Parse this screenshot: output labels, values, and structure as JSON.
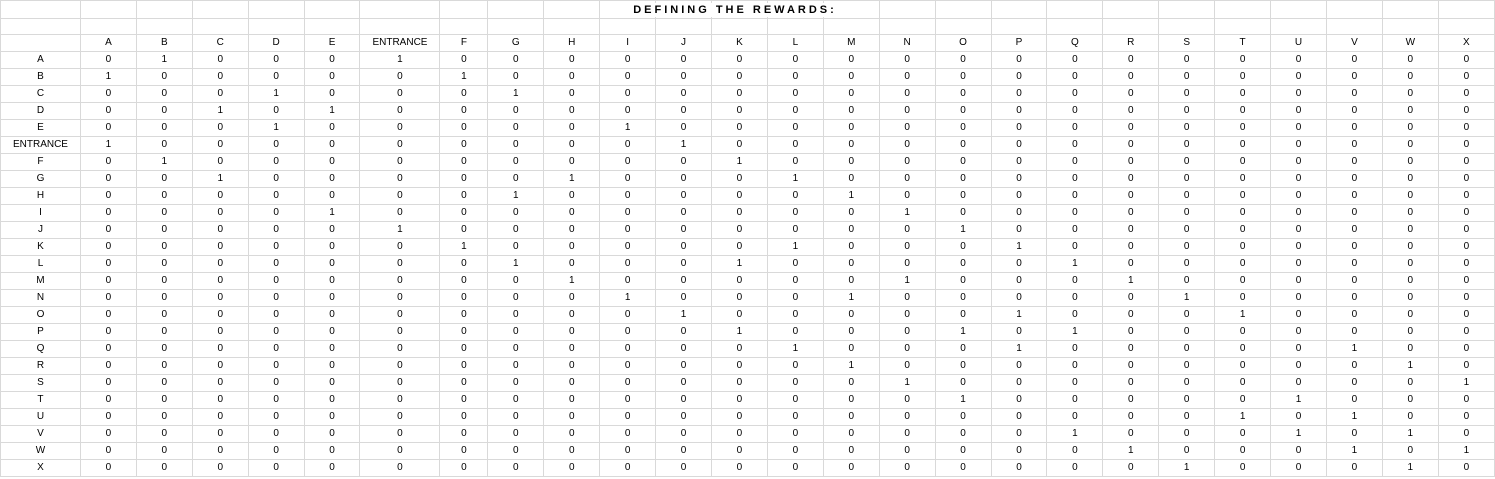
{
  "title": "DEFINING THE REWARDS:",
  "columns": [
    "A",
    "B",
    "C",
    "D",
    "E",
    "ENTRANCE",
    "F",
    "G",
    "H",
    "I",
    "J",
    "K",
    "L",
    "M",
    "N",
    "O",
    "P",
    "Q",
    "R",
    "S",
    "T",
    "U",
    "V",
    "W",
    "X"
  ],
  "rows": [
    {
      "label": "A",
      "values": [
        0,
        1,
        0,
        0,
        0,
        1,
        0,
        0,
        0,
        0,
        0,
        0,
        0,
        0,
        0,
        0,
        0,
        0,
        0,
        0,
        0,
        0,
        0,
        0,
        0
      ]
    },
    {
      "label": "B",
      "values": [
        1,
        0,
        0,
        0,
        0,
        0,
        1,
        0,
        0,
        0,
        0,
        0,
        0,
        0,
        0,
        0,
        0,
        0,
        0,
        0,
        0,
        0,
        0,
        0,
        0
      ]
    },
    {
      "label": "C",
      "values": [
        0,
        0,
        0,
        1,
        0,
        0,
        0,
        1,
        0,
        0,
        0,
        0,
        0,
        0,
        0,
        0,
        0,
        0,
        0,
        0,
        0,
        0,
        0,
        0,
        0
      ]
    },
    {
      "label": "D",
      "values": [
        0,
        0,
        1,
        0,
        1,
        0,
        0,
        0,
        0,
        0,
        0,
        0,
        0,
        0,
        0,
        0,
        0,
        0,
        0,
        0,
        0,
        0,
        0,
        0,
        0
      ]
    },
    {
      "label": "E",
      "values": [
        0,
        0,
        0,
        1,
        0,
        0,
        0,
        0,
        0,
        1,
        0,
        0,
        0,
        0,
        0,
        0,
        0,
        0,
        0,
        0,
        0,
        0,
        0,
        0,
        0
      ]
    },
    {
      "label": "ENTRANCE",
      "values": [
        1,
        0,
        0,
        0,
        0,
        0,
        0,
        0,
        0,
        0,
        1,
        0,
        0,
        0,
        0,
        0,
        0,
        0,
        0,
        0,
        0,
        0,
        0,
        0,
        0
      ]
    },
    {
      "label": "F",
      "values": [
        0,
        1,
        0,
        0,
        0,
        0,
        0,
        0,
        0,
        0,
        0,
        1,
        0,
        0,
        0,
        0,
        0,
        0,
        0,
        0,
        0,
        0,
        0,
        0,
        0
      ]
    },
    {
      "label": "G",
      "values": [
        0,
        0,
        1,
        0,
        0,
        0,
        0,
        0,
        1,
        0,
        0,
        0,
        1,
        0,
        0,
        0,
        0,
        0,
        0,
        0,
        0,
        0,
        0,
        0,
        0
      ]
    },
    {
      "label": "H",
      "values": [
        0,
        0,
        0,
        0,
        0,
        0,
        0,
        1,
        0,
        0,
        0,
        0,
        0,
        1,
        0,
        0,
        0,
        0,
        0,
        0,
        0,
        0,
        0,
        0,
        0
      ]
    },
    {
      "label": "I",
      "values": [
        0,
        0,
        0,
        0,
        1,
        0,
        0,
        0,
        0,
        0,
        0,
        0,
        0,
        0,
        1,
        0,
        0,
        0,
        0,
        0,
        0,
        0,
        0,
        0,
        0
      ]
    },
    {
      "label": "J",
      "values": [
        0,
        0,
        0,
        0,
        0,
        1,
        0,
        0,
        0,
        0,
        0,
        0,
        0,
        0,
        0,
        1,
        0,
        0,
        0,
        0,
        0,
        0,
        0,
        0,
        0
      ]
    },
    {
      "label": "K",
      "values": [
        0,
        0,
        0,
        0,
        0,
        0,
        1,
        0,
        0,
        0,
        0,
        0,
        1,
        0,
        0,
        0,
        1,
        0,
        0,
        0,
        0,
        0,
        0,
        0,
        0
      ]
    },
    {
      "label": "L",
      "values": [
        0,
        0,
        0,
        0,
        0,
        0,
        0,
        1,
        0,
        0,
        0,
        1,
        0,
        0,
        0,
        0,
        0,
        1,
        0,
        0,
        0,
        0,
        0,
        0,
        0
      ]
    },
    {
      "label": "M",
      "values": [
        0,
        0,
        0,
        0,
        0,
        0,
        0,
        0,
        1,
        0,
        0,
        0,
        0,
        0,
        1,
        0,
        0,
        0,
        1,
        0,
        0,
        0,
        0,
        0,
        0
      ]
    },
    {
      "label": "N",
      "values": [
        0,
        0,
        0,
        0,
        0,
        0,
        0,
        0,
        0,
        1,
        0,
        0,
        0,
        1,
        0,
        0,
        0,
        0,
        0,
        1,
        0,
        0,
        0,
        0,
        0
      ]
    },
    {
      "label": "O",
      "values": [
        0,
        0,
        0,
        0,
        0,
        0,
        0,
        0,
        0,
        0,
        1,
        0,
        0,
        0,
        0,
        0,
        1,
        0,
        0,
        0,
        1,
        0,
        0,
        0,
        0
      ]
    },
    {
      "label": "P",
      "values": [
        0,
        0,
        0,
        0,
        0,
        0,
        0,
        0,
        0,
        0,
        0,
        1,
        0,
        0,
        0,
        1,
        0,
        1,
        0,
        0,
        0,
        0,
        0,
        0,
        0
      ]
    },
    {
      "label": "Q",
      "values": [
        0,
        0,
        0,
        0,
        0,
        0,
        0,
        0,
        0,
        0,
        0,
        0,
        1,
        0,
        0,
        0,
        1,
        0,
        0,
        0,
        0,
        0,
        1,
        0,
        0
      ]
    },
    {
      "label": "R",
      "values": [
        0,
        0,
        0,
        0,
        0,
        0,
        0,
        0,
        0,
        0,
        0,
        0,
        0,
        1,
        0,
        0,
        0,
        0,
        0,
        0,
        0,
        0,
        0,
        1,
        0
      ]
    },
    {
      "label": "S",
      "values": [
        0,
        0,
        0,
        0,
        0,
        0,
        0,
        0,
        0,
        0,
        0,
        0,
        0,
        0,
        1,
        0,
        0,
        0,
        0,
        0,
        0,
        0,
        0,
        0,
        1
      ]
    },
    {
      "label": "T",
      "values": [
        0,
        0,
        0,
        0,
        0,
        0,
        0,
        0,
        0,
        0,
        0,
        0,
        0,
        0,
        0,
        1,
        0,
        0,
        0,
        0,
        0,
        1,
        0,
        0,
        0
      ]
    },
    {
      "label": "U",
      "values": [
        0,
        0,
        0,
        0,
        0,
        0,
        0,
        0,
        0,
        0,
        0,
        0,
        0,
        0,
        0,
        0,
        0,
        0,
        0,
        0,
        1,
        0,
        1,
        0,
        0
      ]
    },
    {
      "label": "V",
      "values": [
        0,
        0,
        0,
        0,
        0,
        0,
        0,
        0,
        0,
        0,
        0,
        0,
        0,
        0,
        0,
        0,
        0,
        1,
        0,
        0,
        0,
        1,
        0,
        1,
        0
      ]
    },
    {
      "label": "W",
      "values": [
        0,
        0,
        0,
        0,
        0,
        0,
        0,
        0,
        0,
        0,
        0,
        0,
        0,
        0,
        0,
        0,
        0,
        0,
        1,
        0,
        0,
        0,
        1,
        0,
        1
      ]
    },
    {
      "label": "X",
      "values": [
        0,
        0,
        0,
        0,
        0,
        0,
        0,
        0,
        0,
        0,
        0,
        0,
        0,
        0,
        0,
        0,
        0,
        0,
        0,
        1,
        0,
        0,
        0,
        1,
        0
      ]
    }
  ]
}
